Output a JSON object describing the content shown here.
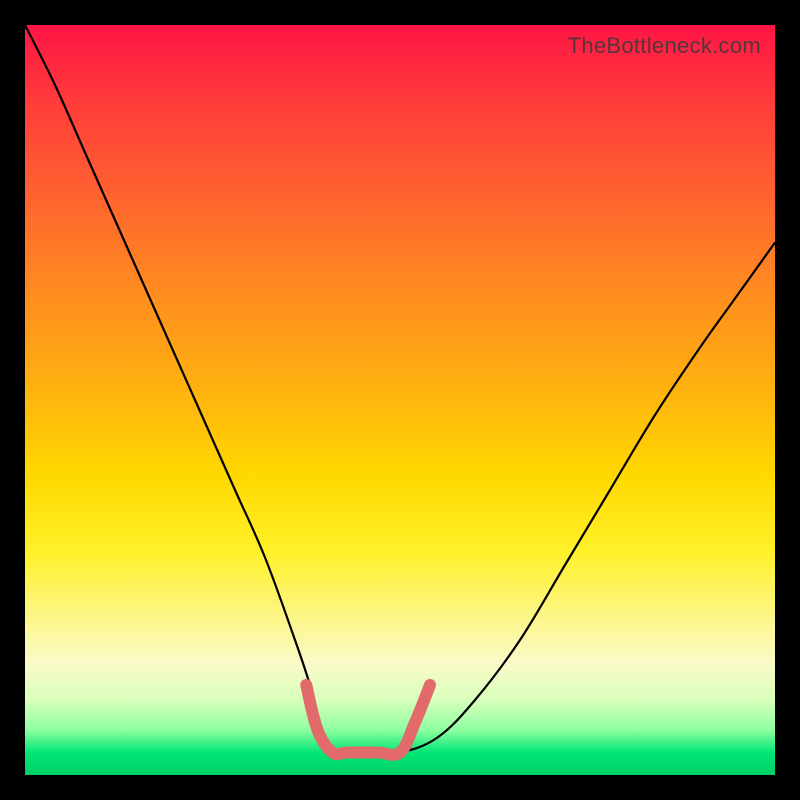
{
  "watermark": "TheBottleneck.com",
  "chart_data": {
    "type": "line",
    "title": "",
    "xlabel": "",
    "ylabel": "",
    "xlim": [
      0,
      100
    ],
    "ylim": [
      0,
      100
    ],
    "series": [
      {
        "name": "black-curve",
        "stroke": "#000000",
        "stroke_width": 2.2,
        "x": [
          0,
          4,
          8,
          12,
          16,
          20,
          24,
          28,
          32,
          36,
          38,
          40,
          42,
          44,
          46,
          50,
          55,
          60,
          66,
          72,
          78,
          84,
          90,
          95,
          100
        ],
        "y": [
          100,
          92,
          83,
          74,
          65,
          56,
          47,
          38,
          29,
          18,
          12,
          5,
          3,
          3,
          3,
          3,
          5,
          10,
          18,
          28,
          38,
          48,
          57,
          64,
          71
        ]
      },
      {
        "name": "pink-optimum-zone",
        "stroke": "#e26a6a",
        "stroke_width": 12,
        "linecap": "round",
        "linejoin": "round",
        "x": [
          37.5,
          39,
          41,
          43,
          47,
          50,
          52,
          54
        ],
        "y": [
          12,
          6,
          3,
          3,
          3,
          3,
          7,
          12
        ]
      }
    ]
  }
}
